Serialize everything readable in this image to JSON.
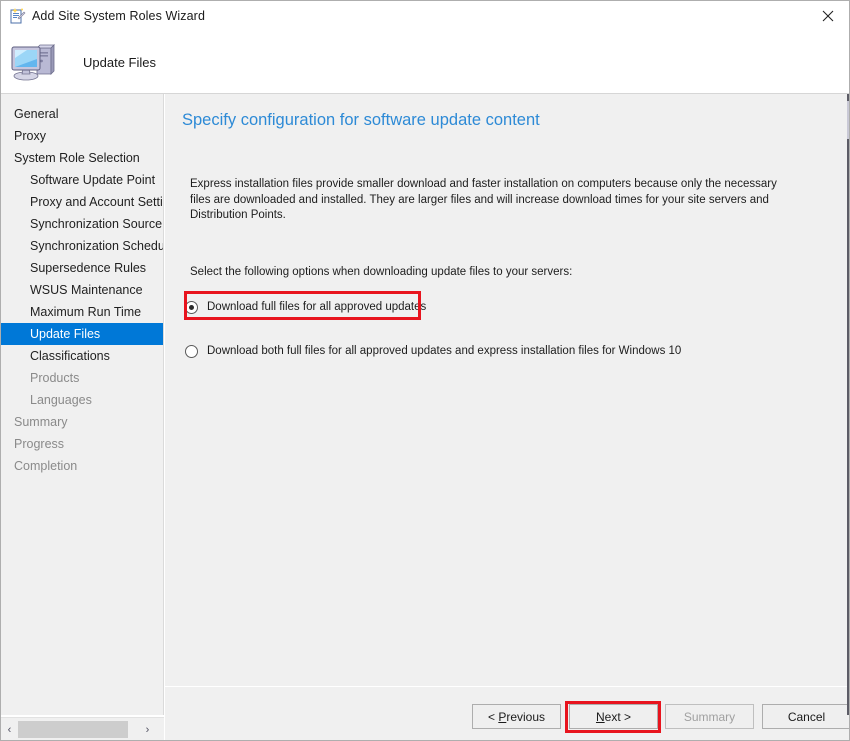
{
  "window": {
    "title": "Add Site System Roles Wizard",
    "title_icon": "wizard-icon",
    "close_label": "✕"
  },
  "header": {
    "title": "Update Files",
    "icon": "computer-icon"
  },
  "sidebar": {
    "items": [
      {
        "label": "General",
        "indent": false,
        "state": "normal"
      },
      {
        "label": "Proxy",
        "indent": false,
        "state": "normal"
      },
      {
        "label": "System Role Selection",
        "indent": false,
        "state": "normal"
      },
      {
        "label": "Software Update Point",
        "indent": true,
        "state": "normal"
      },
      {
        "label": "Proxy and Account Settin",
        "indent": true,
        "state": "normal"
      },
      {
        "label": "Synchronization Source",
        "indent": true,
        "state": "normal"
      },
      {
        "label": "Synchronization Schedule",
        "indent": true,
        "state": "normal"
      },
      {
        "label": "Supersedence Rules",
        "indent": true,
        "state": "normal"
      },
      {
        "label": "WSUS Maintenance",
        "indent": true,
        "state": "normal"
      },
      {
        "label": "Maximum Run Time",
        "indent": true,
        "state": "normal"
      },
      {
        "label": "Update Files",
        "indent": true,
        "state": "selected"
      },
      {
        "label": "Classifications",
        "indent": true,
        "state": "normal"
      },
      {
        "label": "Products",
        "indent": true,
        "state": "disabled"
      },
      {
        "label": "Languages",
        "indent": true,
        "state": "disabled"
      },
      {
        "label": "Summary",
        "indent": false,
        "state": "disabled"
      },
      {
        "label": "Progress",
        "indent": false,
        "state": "disabled"
      },
      {
        "label": "Completion",
        "indent": false,
        "state": "disabled"
      }
    ],
    "hscroll": {
      "left_arrow": "‹",
      "right_arrow": "›"
    }
  },
  "content": {
    "page_title": "Specify configuration for software update content",
    "description": "Express installation files provide smaller download and faster installation on computers because only the necessary files are downloaded and installed.  They are larger files and will increase download times for your site servers and Distribution Points.",
    "prompt": "Select the following options when downloading update files to your servers:",
    "options": [
      {
        "label": "Download full files for all approved updates",
        "checked": true,
        "highlighted": true
      },
      {
        "label": "Download both full files for all approved updates and express installation files for Windows 10",
        "checked": false,
        "highlighted": false
      }
    ]
  },
  "footer": {
    "buttons": [
      {
        "label": "< Previous",
        "accel": "P",
        "disabled": false,
        "highlighted": false
      },
      {
        "label": "Next >",
        "accel": "N",
        "disabled": false,
        "highlighted": true
      },
      {
        "label": "Summary",
        "accel": "",
        "disabled": true,
        "highlighted": false
      },
      {
        "label": "Cancel",
        "accel": "",
        "disabled": false,
        "highlighted": false
      }
    ]
  },
  "colors": {
    "accent_blue": "#0078d7",
    "title_blue": "#2d8ad6",
    "highlight_red": "#e8141e",
    "panel_gray": "#f0f0f0"
  }
}
